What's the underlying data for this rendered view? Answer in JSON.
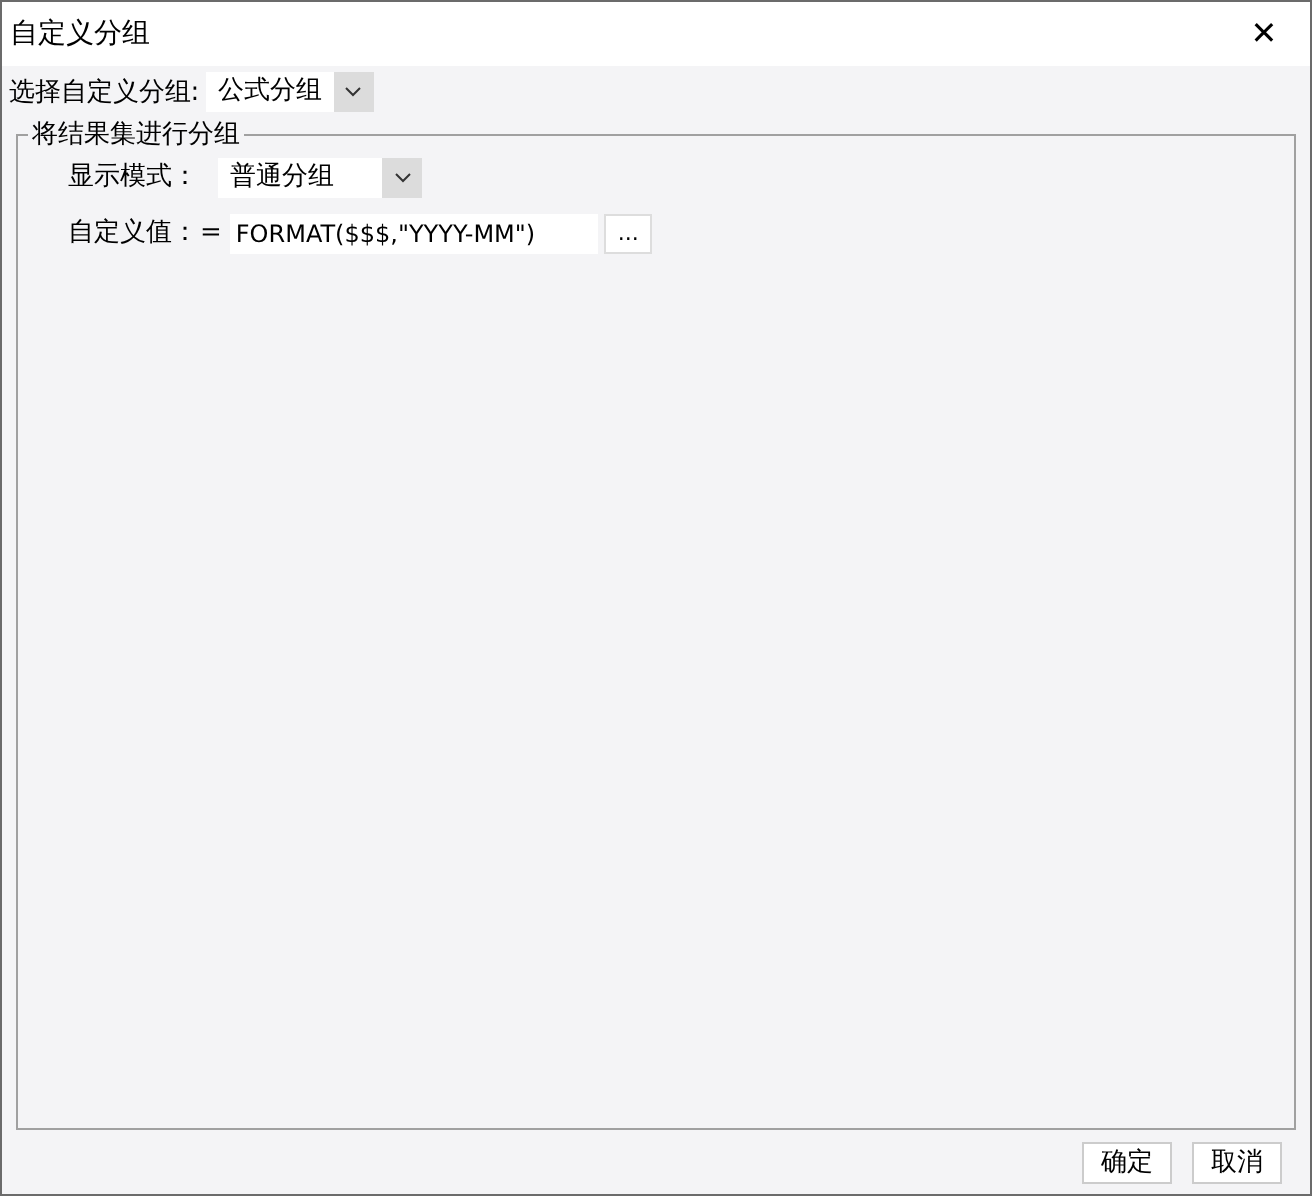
{
  "window": {
    "title": "自定义分组",
    "close": "✕"
  },
  "group_select": {
    "label": "选择自定义分组:",
    "value": "公式分组"
  },
  "fieldset": {
    "legend": "将结果集进行分组",
    "display_mode": {
      "label": "显示模式：",
      "value": "普通分组"
    },
    "custom_value": {
      "label": "自定义值：",
      "prefix": "=",
      "value": "FORMAT($$$,\"YYYY-MM\")",
      "button": "..."
    }
  },
  "buttons": [
    "确定",
    "取消"
  ]
}
